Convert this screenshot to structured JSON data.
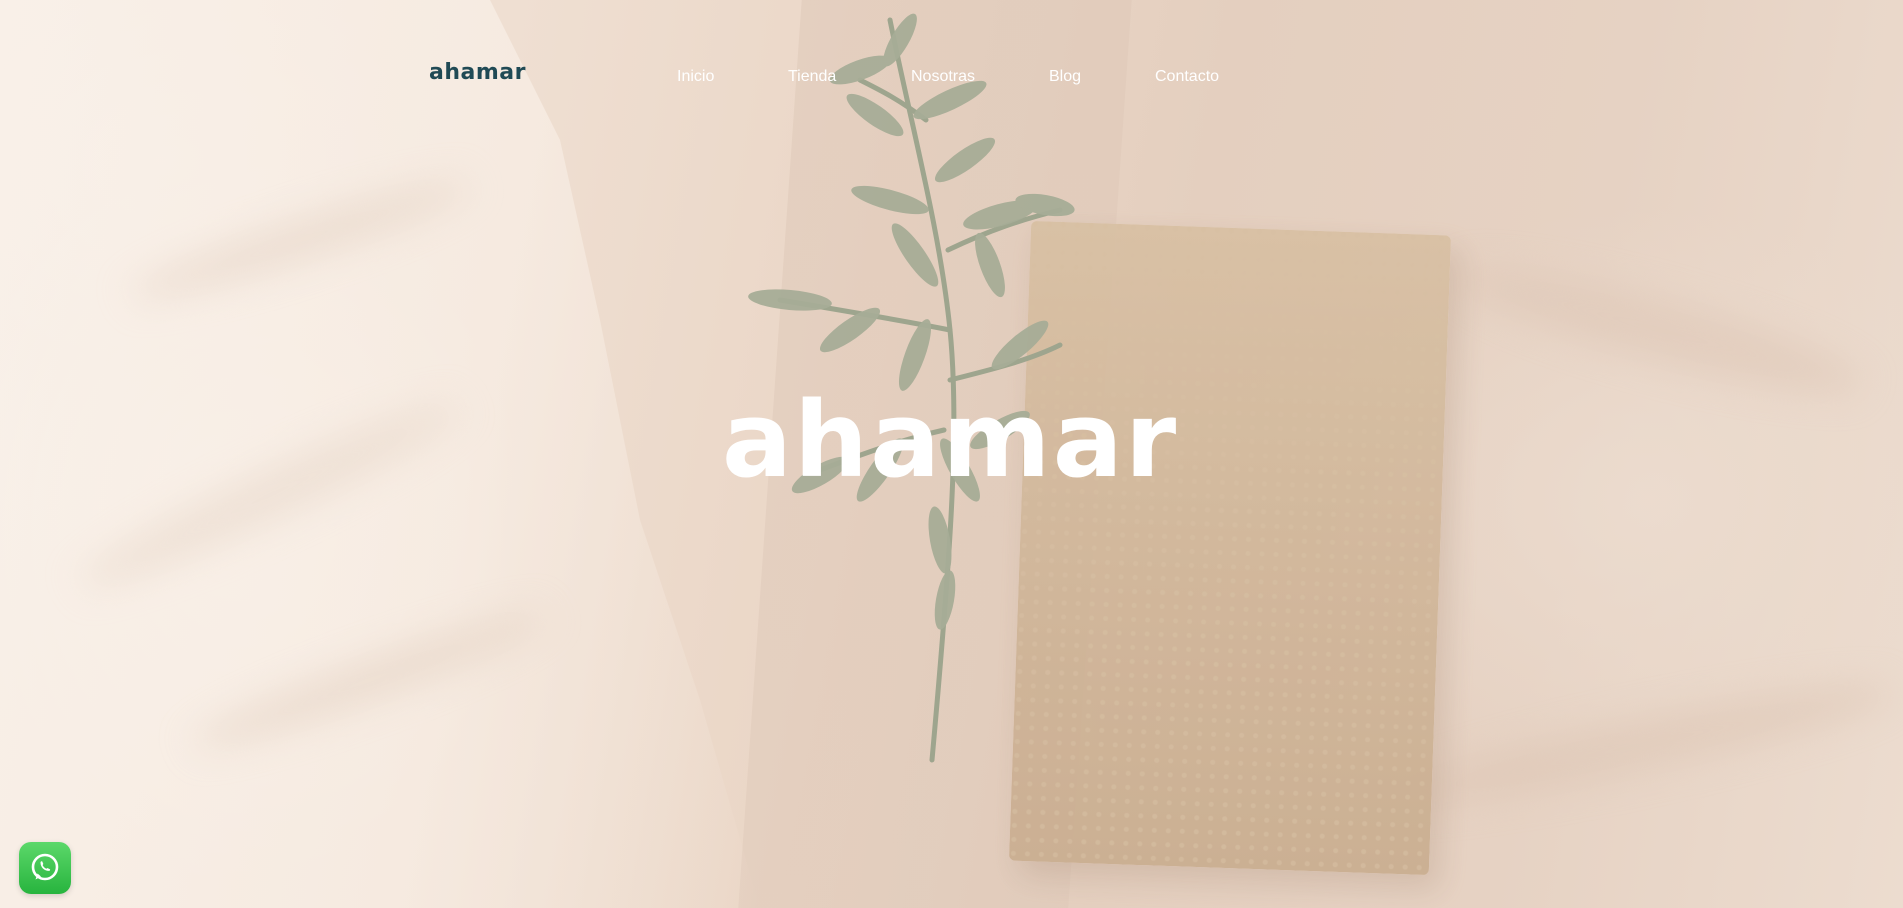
{
  "brand": {
    "logo_text": "ahamar",
    "logo_color": "#204a55",
    "hero_logo_text": "ahamar",
    "hero_logo_color": "#ffffff"
  },
  "nav": {
    "items": [
      {
        "label": "Inicio"
      },
      {
        "label": "Tienda"
      },
      {
        "label": "Nosotras"
      },
      {
        "label": "Blog"
      },
      {
        "label": "Contacto"
      }
    ]
  },
  "floating": {
    "whatsapp_icon": "whatsapp-icon",
    "whatsapp_color": "#27b43e"
  },
  "hero": {
    "background_image": "beige linen fabric, olive sprig and handmade paper"
  }
}
